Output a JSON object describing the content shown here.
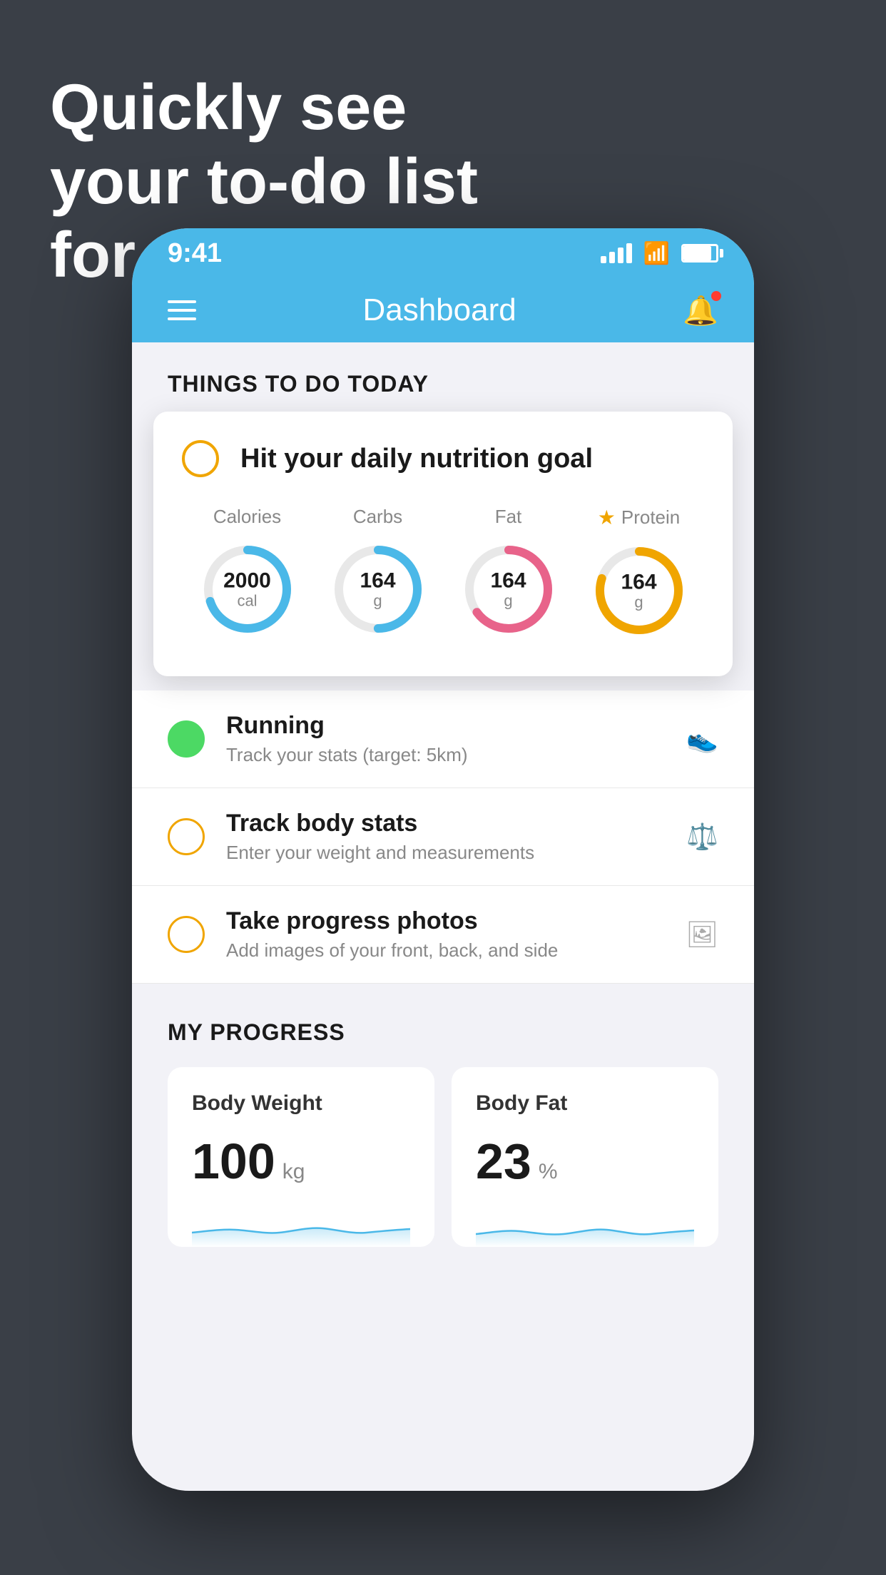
{
  "background": {
    "color": "#3a3f47"
  },
  "headline": {
    "line1": "Quickly see",
    "line2": "your to-do list",
    "line3": "for the day."
  },
  "phone": {
    "statusBar": {
      "time": "9:41",
      "signalBars": [
        1,
        2,
        3,
        4
      ],
      "wifi": "wifi",
      "battery": "battery"
    },
    "navBar": {
      "title": "Dashboard",
      "menuIcon": "hamburger",
      "bellIcon": "bell"
    },
    "thingsToDo": {
      "sectionTitle": "THINGS TO DO TODAY",
      "nutritionCard": {
        "checkIcon": "circle",
        "title": "Hit your daily nutrition goal",
        "macros": [
          {
            "label": "Calories",
            "value": "2000",
            "unit": "cal",
            "color": "#4ab8e8",
            "progress": 0.7,
            "starred": false
          },
          {
            "label": "Carbs",
            "value": "164",
            "unit": "g",
            "color": "#4ab8e8",
            "progress": 0.5,
            "starred": false
          },
          {
            "label": "Fat",
            "value": "164",
            "unit": "g",
            "color": "#e8638a",
            "progress": 0.65,
            "starred": false
          },
          {
            "label": "Protein",
            "value": "164",
            "unit": "g",
            "color": "#f0a500",
            "progress": 0.8,
            "starred": true
          }
        ]
      },
      "todoItems": [
        {
          "name": "Running",
          "desc": "Track your stats (target: 5km)",
          "circleColor": "green",
          "icon": "shoe"
        },
        {
          "name": "Track body stats",
          "desc": "Enter your weight and measurements",
          "circleColor": "yellow",
          "icon": "scale"
        },
        {
          "name": "Take progress photos",
          "desc": "Add images of your front, back, and side",
          "circleColor": "yellow",
          "icon": "person"
        }
      ]
    },
    "myProgress": {
      "sectionTitle": "MY PROGRESS",
      "cards": [
        {
          "title": "Body Weight",
          "value": "100",
          "unit": "kg",
          "chartColor": "#4ab8e8"
        },
        {
          "title": "Body Fat",
          "value": "23",
          "unit": "%",
          "chartColor": "#4ab8e8"
        }
      ]
    }
  }
}
